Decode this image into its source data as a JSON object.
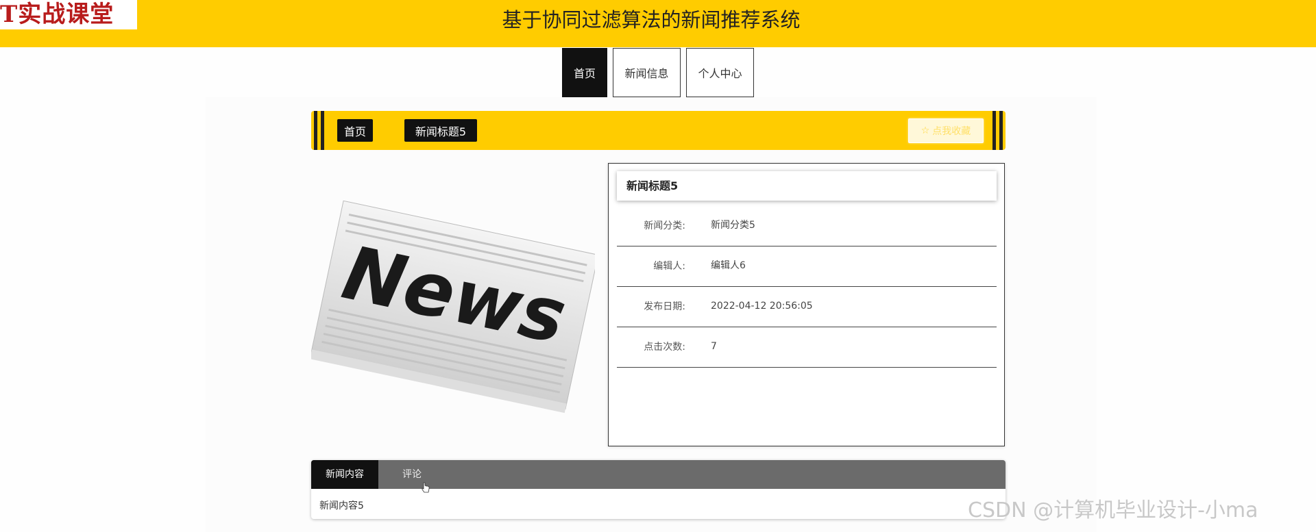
{
  "header": {
    "logo_text": "T实战课堂",
    "site_title": "基于协同过滤算法的新闻推荐系统"
  },
  "nav": {
    "home": "首页",
    "news": "新闻信息",
    "user": "个人中心",
    "active": "首页"
  },
  "breadcrumb": {
    "home": "首页",
    "current": "新闻标题5",
    "favorite_button": "点我收藏",
    "favorite_icon": "star-icon"
  },
  "image": {
    "text": "News"
  },
  "detail": {
    "title": "新闻标题5",
    "fields": [
      {
        "label": "新闻分类:",
        "value": "新闻分类5"
      },
      {
        "label": "编辑人:",
        "value": "编辑人6"
      },
      {
        "label": "发布日期:",
        "value": "2022-04-12 20:56:05"
      },
      {
        "label": "点击次数:",
        "value": "7"
      }
    ]
  },
  "tabs": {
    "items": [
      "新闻内容",
      "评论"
    ],
    "active": "新闻内容",
    "content": "新闻内容5"
  },
  "watermark": "CSDN @计算机毕业设计-小ma",
  "colors": {
    "accent": "#ffcc00",
    "dark": "#111111",
    "tabbar": "#6b6b6b"
  }
}
